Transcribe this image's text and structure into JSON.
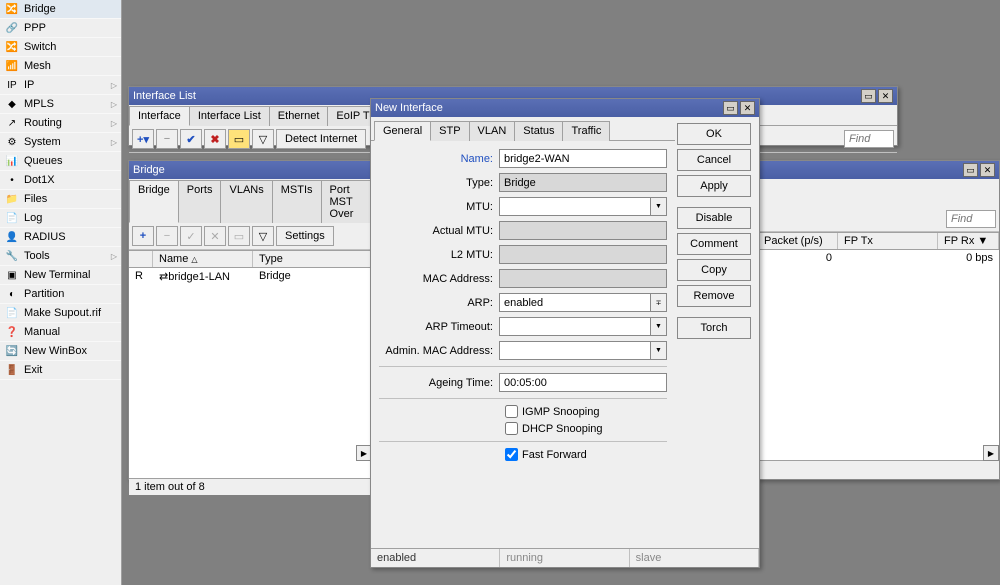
{
  "sidebar": {
    "items": [
      {
        "label": "Bridge",
        "icon": "🔀",
        "arrow": false
      },
      {
        "label": "PPP",
        "icon": "🔗",
        "arrow": false
      },
      {
        "label": "Switch",
        "icon": "🔀",
        "arrow": false
      },
      {
        "label": "Mesh",
        "icon": "📶",
        "arrow": false
      },
      {
        "label": "IP",
        "icon": "IP",
        "arrow": true
      },
      {
        "label": "MPLS",
        "icon": "◆",
        "arrow": true
      },
      {
        "label": "Routing",
        "icon": "↗",
        "arrow": true
      },
      {
        "label": "System",
        "icon": "⚙",
        "arrow": true
      },
      {
        "label": "Queues",
        "icon": "📊",
        "arrow": false
      },
      {
        "label": "Dot1X",
        "icon": "•",
        "arrow": false
      },
      {
        "label": "Files",
        "icon": "📁",
        "arrow": false
      },
      {
        "label": "Log",
        "icon": "📄",
        "arrow": false
      },
      {
        "label": "RADIUS",
        "icon": "👤",
        "arrow": false
      },
      {
        "label": "Tools",
        "icon": "🔧",
        "arrow": true
      },
      {
        "label": "New Terminal",
        "icon": "▣",
        "arrow": false
      },
      {
        "label": "Partition",
        "icon": "◐",
        "arrow": false
      },
      {
        "label": "Make Supout.rif",
        "icon": "📄",
        "arrow": false
      },
      {
        "label": "Manual",
        "icon": "❓",
        "arrow": false
      },
      {
        "label": "New WinBox",
        "icon": "🔄",
        "arrow": false
      },
      {
        "label": "Exit",
        "icon": "🚪",
        "arrow": false
      }
    ]
  },
  "win_iface": {
    "title": "Interface List",
    "tabs": [
      "Interface",
      "Interface List",
      "Ethernet",
      "EoIP Tunnel"
    ],
    "find_ph": "Find",
    "detect": "Detect Internet"
  },
  "win_right": {
    "find_ph": "Find",
    "cols": [
      "Packet (p/s)",
      "FP Tx",
      "FP Rx"
    ],
    "vals": [
      "0",
      "0 bps"
    ]
  },
  "win_bridge": {
    "title": "Bridge",
    "tabs": [
      "Bridge",
      "Ports",
      "VLANs",
      "MSTIs",
      "Port MST Over"
    ],
    "settings": "Settings",
    "cols": {
      "flag": "",
      "name": "Name",
      "type": "Type"
    },
    "row": {
      "flag": "R",
      "name": "bridge1-LAN",
      "type": "Bridge",
      "icon": "⇄"
    },
    "status": "1 item out of 8"
  },
  "dialog": {
    "title": "New Interface",
    "tabs": [
      "General",
      "STP",
      "VLAN",
      "Status",
      "Traffic"
    ],
    "labels": {
      "name": "Name:",
      "type": "Type:",
      "mtu": "MTU:",
      "actual_mtu": "Actual MTU:",
      "l2mtu": "L2 MTU:",
      "mac": "MAC Address:",
      "arp": "ARP:",
      "arp_to": "ARP Timeout:",
      "admin_mac": "Admin. MAC Address:",
      "ageing": "Ageing Time:"
    },
    "values": {
      "name": "bridge2-WAN",
      "type": "Bridge",
      "mtu": "",
      "actual_mtu": "",
      "l2mtu": "",
      "mac": "",
      "arp": "enabled",
      "arp_to": "",
      "admin_mac": "",
      "ageing": "00:05:00"
    },
    "checks": {
      "igmp": "IGMP Snooping",
      "dhcp": "DHCP Snooping",
      "ff": "Fast Forward"
    },
    "check_state": {
      "igmp": false,
      "dhcp": false,
      "ff": true
    },
    "buttons": {
      "ok": "OK",
      "cancel": "Cancel",
      "apply": "Apply",
      "disable": "Disable",
      "comment": "Comment",
      "copy": "Copy",
      "remove": "Remove",
      "torch": "Torch"
    },
    "status": {
      "s1": "enabled",
      "s2": "running",
      "s3": "slave"
    }
  }
}
